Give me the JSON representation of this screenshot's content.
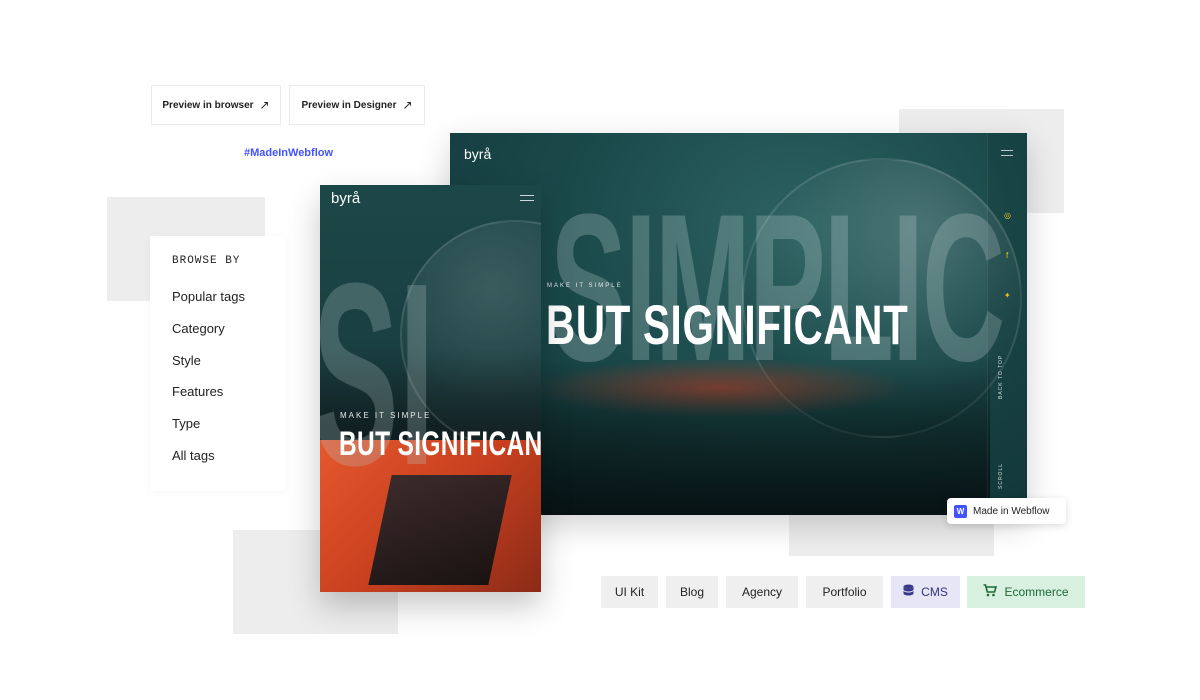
{
  "buttons": {
    "preview_browser": "Preview in browser",
    "preview_designer": "Preview in Designer",
    "arrow_glyph": "↗"
  },
  "hashtag": "#MadeInWebflow",
  "browse": {
    "title": "BROWSE BY",
    "items": [
      "Popular tags",
      "Category",
      "Style",
      "Features",
      "Type",
      "All tags"
    ]
  },
  "desktop": {
    "brand": "byrå",
    "bg_word": "SIMPLIC",
    "eyebrow": "MAKE IT SIMPLE",
    "headline": "BUT SIGNIFICANT",
    "social": {
      "instagram": "◎",
      "facebook": "f",
      "twitter": "✦"
    },
    "back_to_top": "BACK TO TOP",
    "scroll": "SCROLL"
  },
  "mobile": {
    "brand": "byrå",
    "bg_word": "SI",
    "eyebrow": "MAKE IT SIMPLE",
    "headline": "BUT SIGNIFICANT"
  },
  "badge": {
    "label": "Made in Webflow",
    "logo": "W"
  },
  "tags": [
    {
      "label": "UI Kit"
    },
    {
      "label": "Blog"
    },
    {
      "label": "Agency"
    },
    {
      "label": "Portfolio"
    },
    {
      "label": "CMS",
      "icon": "database-icon"
    },
    {
      "label": "Ecommerce",
      "icon": "cart-icon"
    }
  ],
  "colors": {
    "accent": "#4353ff",
    "cms_bg": "#e6e6f7",
    "ecommerce_bg": "#d7f0df",
    "social_icon": "#f0c419"
  }
}
